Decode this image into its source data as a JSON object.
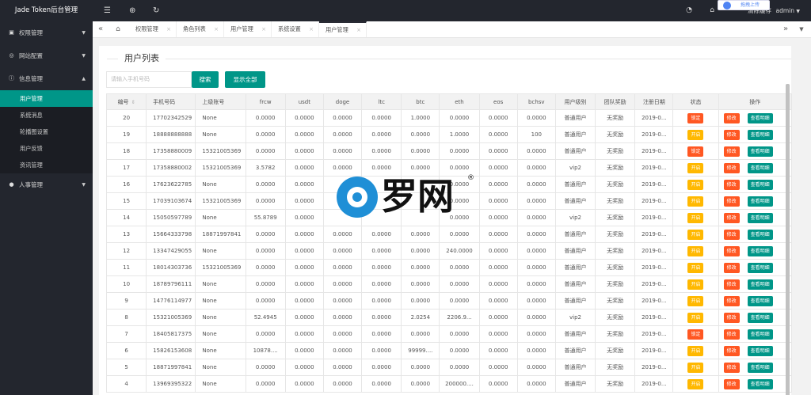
{
  "app": {
    "title": "Jade Token后台管理"
  },
  "sidebar": {
    "groups": [
      {
        "label": "权限管理",
        "icon": "lock-icon"
      },
      {
        "label": "网站配置",
        "icon": "globe-icon"
      },
      {
        "label": "信息管理",
        "icon": "info-icon",
        "items": [
          "用户管理",
          "系统消息",
          "轮播图设置",
          "用户反馈",
          "资讯管理"
        ],
        "active": "用户管理"
      },
      {
        "label": "人事管理",
        "icon": "person-icon"
      }
    ]
  },
  "header": {
    "user_label": "清除缓存",
    "admin_label": "admin",
    "upload_label": "拖拽上传"
  },
  "tabs": [
    {
      "label": "权限管理"
    },
    {
      "label": "角色列表"
    },
    {
      "label": "用户管理"
    },
    {
      "label": "系统设置"
    },
    {
      "label": "用户管理"
    }
  ],
  "main": {
    "title": "用户列表",
    "search_placeholder": "请输入手机号码",
    "search_button": "搜索",
    "show_all_button": "显示全部"
  },
  "table": {
    "columns": [
      "编号",
      "手机号码",
      "上级账号",
      "frcw",
      "usdt",
      "doge",
      "ltc",
      "btc",
      "eth",
      "eos",
      "bchsv",
      "用户级别",
      "团队奖励",
      "注册日期",
      "状态",
      "操作"
    ],
    "action_labels": {
      "edit": "修改",
      "detail": "查看明细",
      "lock": "锁定",
      "open": "开启"
    },
    "rows": [
      [
        "20",
        "17702342529",
        "None",
        "0.0000",
        "0.0000",
        "0.0000",
        "0.0000",
        "1.0000",
        "0.0000",
        "0.0000",
        "0.0000",
        "普通用户",
        "无奖励",
        "2019-0...",
        "锁定"
      ],
      [
        "19",
        "18888888888",
        "None",
        "0.0000",
        "0.0000",
        "0.0000",
        "0.0000",
        "0.0000",
        "1.0000",
        "0.0000",
        "100",
        "普通用户",
        "无奖励",
        "2019-0...",
        "开启"
      ],
      [
        "18",
        "17358880009",
        "15321005369",
        "0.0000",
        "0.0000",
        "0.0000",
        "0.0000",
        "0.0000",
        "0.0000",
        "0.0000",
        "0.0000",
        "普通用户",
        "无奖励",
        "2019-0...",
        "锁定"
      ],
      [
        "17",
        "17358880002",
        "15321005369",
        "3.5782",
        "0.0000",
        "0.0000",
        "0.0000",
        "0.0000",
        "0.0000",
        "0.0000",
        "0.0000",
        "vip2",
        "无奖励",
        "2019-0...",
        "开启"
      ],
      [
        "16",
        "17623622785",
        "None",
        "0.0000",
        "0.0000",
        "",
        "",
        "",
        "0.0000",
        "0.0000",
        "0.0000",
        "普通用户",
        "无奖励",
        "2019-0...",
        "开启"
      ],
      [
        "15",
        "17039103674",
        "15321005369",
        "0.0000",
        "0.0000",
        "",
        "",
        "",
        "0.0000",
        "0.0000",
        "0.0000",
        "普通用户",
        "无奖励",
        "2019-0...",
        "开启"
      ],
      [
        "14",
        "15050597789",
        "None",
        "55.8789",
        "0.0000",
        "",
        "",
        "",
        "0.0000",
        "0.0000",
        "0.0000",
        "vip2",
        "无奖励",
        "2019-0...",
        "开启"
      ],
      [
        "13",
        "15664333798",
        "18871997841",
        "0.0000",
        "0.0000",
        "0.0000",
        "0.0000",
        "0.0000",
        "0.0000",
        "0.0000",
        "0.0000",
        "普通用户",
        "无奖励",
        "2019-0...",
        "开启"
      ],
      [
        "12",
        "13347429055",
        "None",
        "0.0000",
        "0.0000",
        "0.0000",
        "0.0000",
        "0.0000",
        "240.0000",
        "0.0000",
        "0.0000",
        "普通用户",
        "无奖励",
        "2019-0...",
        "开启"
      ],
      [
        "11",
        "18014303736",
        "15321005369",
        "0.0000",
        "0.0000",
        "0.0000",
        "0.0000",
        "0.0000",
        "0.0000",
        "0.0000",
        "0.0000",
        "普通用户",
        "无奖励",
        "2019-0...",
        "开启"
      ],
      [
        "10",
        "18789796111",
        "None",
        "0.0000",
        "0.0000",
        "0.0000",
        "0.0000",
        "0.0000",
        "0.0000",
        "0.0000",
        "0.0000",
        "普通用户",
        "无奖励",
        "2019-0...",
        "开启"
      ],
      [
        "9",
        "14776114977",
        "None",
        "0.0000",
        "0.0000",
        "0.0000",
        "0.0000",
        "0.0000",
        "0.0000",
        "0.0000",
        "0.0000",
        "普通用户",
        "无奖励",
        "2019-0...",
        "开启"
      ],
      [
        "8",
        "15321005369",
        "None",
        "52.4945",
        "0.0000",
        "0.0000",
        "0.0000",
        "2.0254",
        "2206.9...",
        "0.0000",
        "0.0000",
        "vip2",
        "无奖励",
        "2019-0...",
        "开启"
      ],
      [
        "7",
        "18405817375",
        "None",
        "0.0000",
        "0.0000",
        "0.0000",
        "0.0000",
        "0.0000",
        "0.0000",
        "0.0000",
        "0.0000",
        "普通用户",
        "无奖励",
        "2019-0...",
        "锁定"
      ],
      [
        "6",
        "15826153608",
        "None",
        "10878....",
        "0.0000",
        "0.0000",
        "0.0000",
        "99999....",
        "0.0000",
        "0.0000",
        "0.0000",
        "普通用户",
        "无奖励",
        "2019-0...",
        "开启"
      ],
      [
        "5",
        "18871997841",
        "None",
        "0.0000",
        "0.0000",
        "0.0000",
        "0.0000",
        "0.0000",
        "0.0000",
        "0.0000",
        "0.0000",
        "普通用户",
        "无奖励",
        "2019-0...",
        "开启"
      ],
      [
        "4",
        "13969395322",
        "None",
        "0.0000",
        "0.0000",
        "0.0000",
        "0.0000",
        "0.0000",
        "200000....",
        "0.0000",
        "0.0000",
        "普通用户",
        "无奖励",
        "2019-0...",
        "开启"
      ]
    ]
  },
  "watermark": {
    "text": "罗网",
    "reg": "®"
  },
  "colors": {
    "accent": "#009688",
    "danger": "#ff5722",
    "warn": "#ffb800",
    "sidebar": "#23262e"
  }
}
